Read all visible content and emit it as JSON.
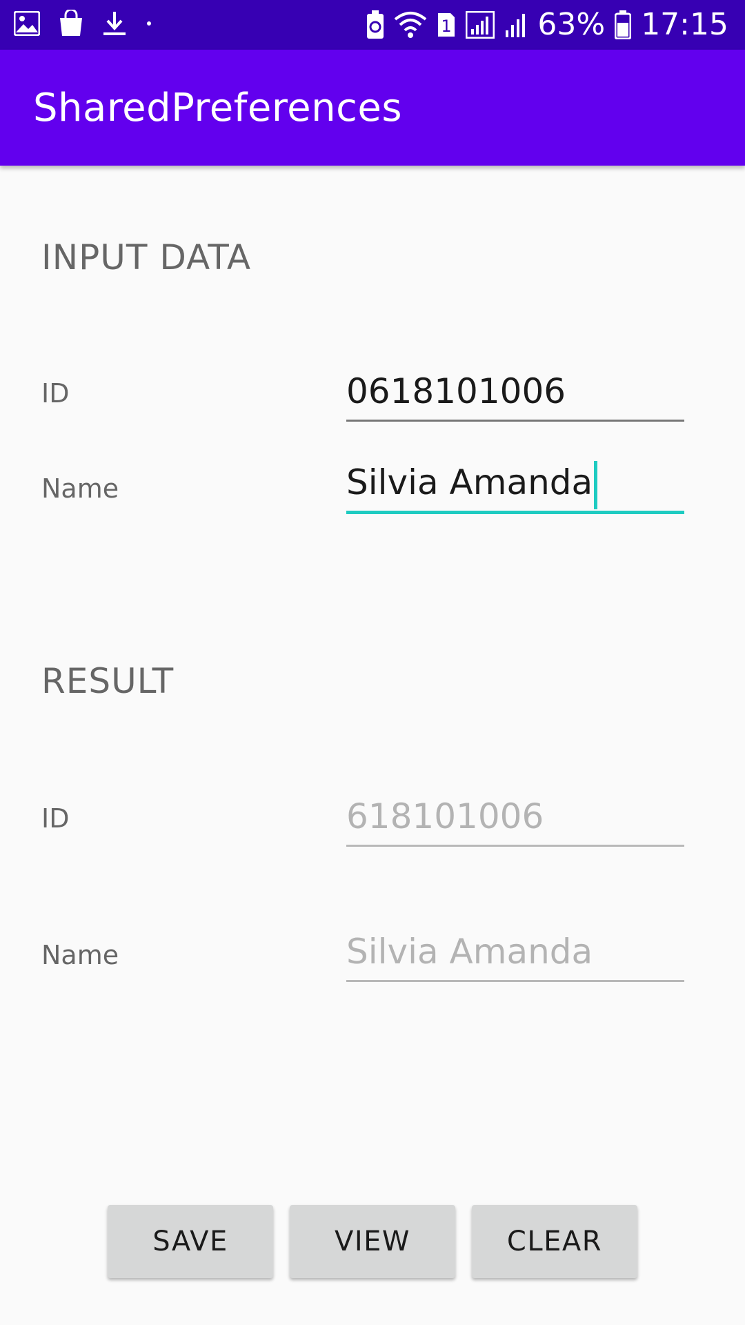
{
  "status_bar": {
    "left_icons": [
      "image-icon",
      "shopping-bag-icon",
      "download-icon",
      "dot-icon"
    ],
    "right_icons": [
      "recycle-battery-icon",
      "wifi-icon",
      "sim-1-icon",
      "signal-icon",
      "signal-2-icon",
      "battery-icon"
    ],
    "sim_label": "1",
    "battery": "63%",
    "time": "17:15"
  },
  "app_bar": {
    "title": "SharedPreferences"
  },
  "input_section": {
    "header": "INPUT DATA",
    "id_label": "ID",
    "id_value": "0618101006",
    "name_label": "Name",
    "name_value": "Silvia Amanda"
  },
  "result_section": {
    "header": "RESULT",
    "id_label": "ID",
    "id_value": "618101006",
    "name_label": "Name",
    "name_value": "Silvia Amanda"
  },
  "buttons": {
    "save": "SAVE",
    "view": "VIEW",
    "clear": "CLEAR"
  },
  "colors": {
    "status_bar": "#3700b3",
    "app_bar": "#6200ee",
    "accent": "#1ecbc1",
    "background": "#fafafa"
  }
}
